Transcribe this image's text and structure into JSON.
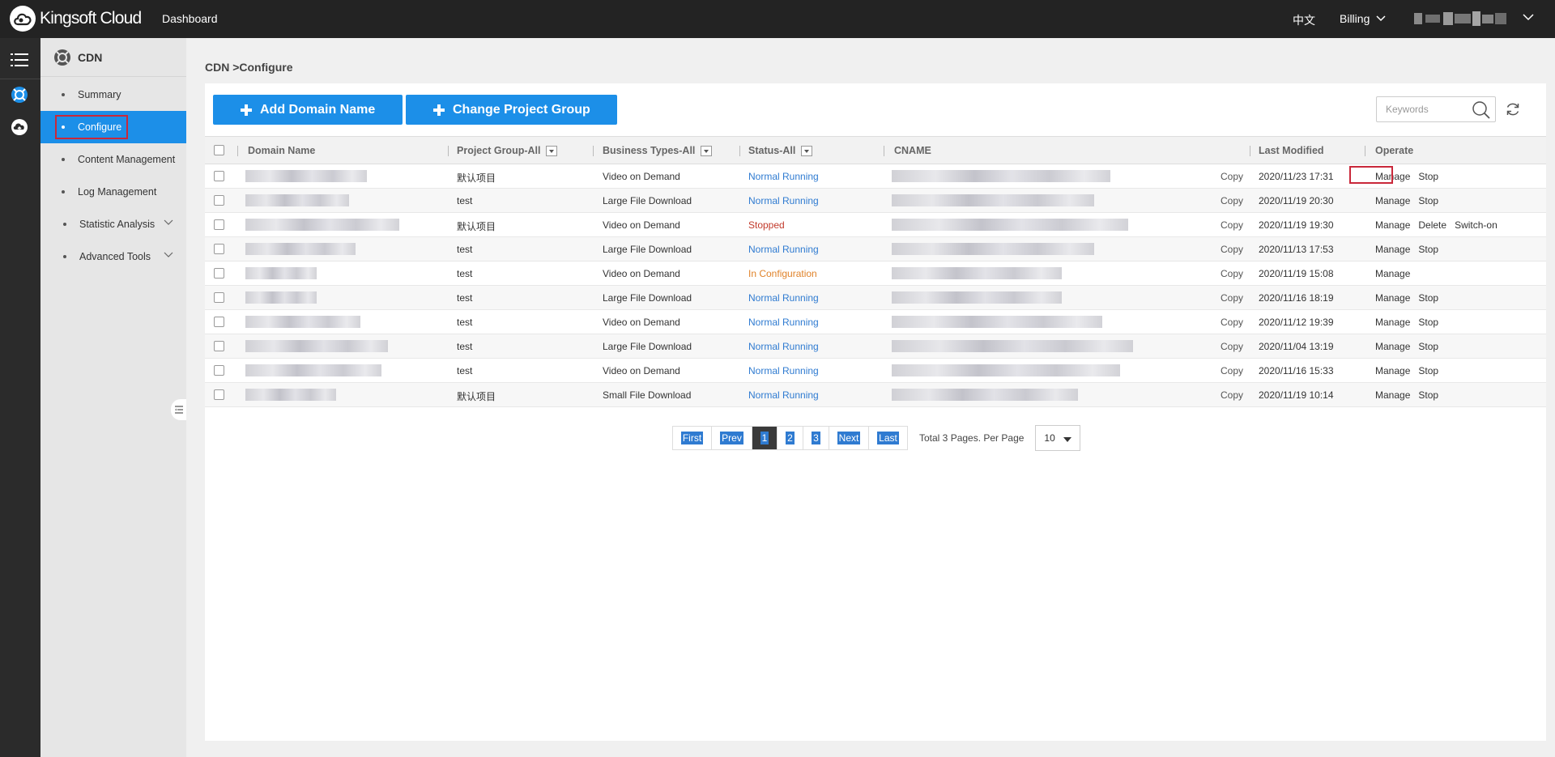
{
  "topbar": {
    "brand": "Kingsoft Cloud",
    "dashboard": "Dashboard",
    "language": "中文",
    "billing": "Billing"
  },
  "sidebar": {
    "title": "CDN",
    "items": [
      {
        "label": "Summary",
        "active": false
      },
      {
        "label": "Configure",
        "active": true
      },
      {
        "label": "Content Management",
        "active": false
      },
      {
        "label": "Log Management",
        "active": false
      },
      {
        "label": "Statistic Analysis",
        "active": false,
        "expandable": true
      },
      {
        "label": "Advanced Tools",
        "active": false,
        "expandable": true
      }
    ]
  },
  "breadcrumb": "CDN >Configure",
  "toolbar": {
    "add_domain": "Add Domain Name",
    "change_group": "Change Project Group",
    "search_placeholder": "Keywords"
  },
  "table": {
    "headers": {
      "domain": "Domain Name",
      "project": "Project Group-All",
      "business": "Business Types-All",
      "status": "Status-All",
      "cname": "CNAME",
      "modified": "Last Modified",
      "operate": "Operate"
    },
    "copy_label": "Copy",
    "rows": [
      {
        "project": "默认项目",
        "business": "Video on Demand",
        "status": "Normal Running",
        "status_kind": "running",
        "modified": "2020/11/23 17:31",
        "ops": [
          "Manage",
          "Stop"
        ]
      },
      {
        "project": "test",
        "business": "Large File Download",
        "status": "Normal Running",
        "status_kind": "running",
        "modified": "2020/11/19 20:30",
        "ops": [
          "Manage",
          "Stop"
        ]
      },
      {
        "project": "默认项目",
        "business": "Video on Demand",
        "status": "Stopped",
        "status_kind": "stopped",
        "modified": "2020/11/19 19:30",
        "ops": [
          "Manage",
          "Delete",
          "Switch-on"
        ]
      },
      {
        "project": "test",
        "business": "Large File Download",
        "status": "Normal Running",
        "status_kind": "running",
        "modified": "2020/11/13 17:53",
        "ops": [
          "Manage",
          "Stop"
        ]
      },
      {
        "project": "test",
        "business": "Video on Demand",
        "status": "In Configuration",
        "status_kind": "config",
        "modified": "2020/11/19 15:08",
        "ops": [
          "Manage"
        ]
      },
      {
        "project": "test",
        "business": "Large File Download",
        "status": "Normal Running",
        "status_kind": "running",
        "modified": "2020/11/16 18:19",
        "ops": [
          "Manage",
          "Stop"
        ]
      },
      {
        "project": "test",
        "business": "Video on Demand",
        "status": "Normal Running",
        "status_kind": "running",
        "modified": "2020/11/12 19:39",
        "ops": [
          "Manage",
          "Stop"
        ]
      },
      {
        "project": "test",
        "business": "Large File Download",
        "status": "Normal Running",
        "status_kind": "running",
        "modified": "2020/11/04 13:19",
        "ops": [
          "Manage",
          "Stop"
        ]
      },
      {
        "project": "test",
        "business": "Video on Demand",
        "status": "Normal Running",
        "status_kind": "running",
        "modified": "2020/11/16 15:33",
        "ops": [
          "Manage",
          "Stop"
        ]
      },
      {
        "project": "默认项目",
        "business": "Small File Download",
        "status": "Normal Running",
        "status_kind": "running",
        "modified": "2020/11/19 10:14",
        "ops": [
          "Manage",
          "Stop"
        ]
      }
    ]
  },
  "pagination": {
    "first": "First",
    "prev": "Prev",
    "pages": [
      "1",
      "2",
      "3"
    ],
    "current": "1",
    "next": "Next",
    "last": "Last",
    "info": "Total 3 Pages. Per Page",
    "per_page": "10"
  },
  "colors": {
    "accent": "#1c8fe8",
    "running": "#2f7bd1",
    "stopped": "#c23a2b",
    "config": "#e0832a",
    "highlight": "#c9283a"
  }
}
